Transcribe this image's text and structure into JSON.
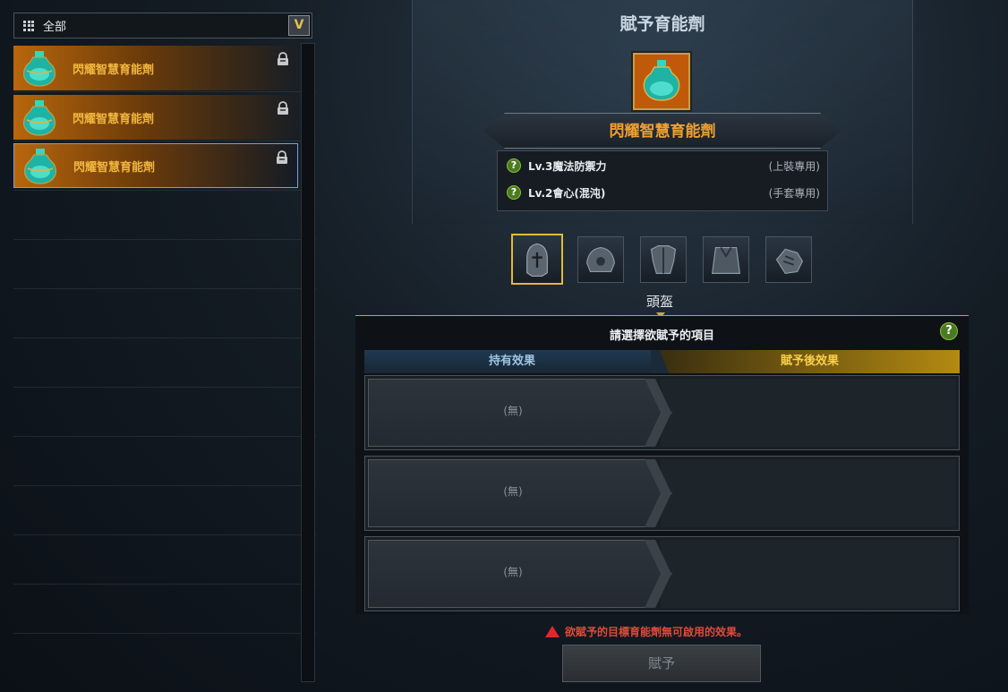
{
  "filter": {
    "label": "全部",
    "dropdown_glyph": "V"
  },
  "inventory": {
    "items": [
      {
        "name": "閃耀智慧育能劑",
        "icon": "teal-potion-icon",
        "locked": true,
        "selected": false
      },
      {
        "name": "閃耀智慧育能劑",
        "icon": "teal-potion-icon",
        "locked": true,
        "selected": false
      },
      {
        "name": "閃耀智慧育能劑",
        "icon": "teal-potion-icon",
        "locked": true,
        "selected": true
      }
    ]
  },
  "panel": {
    "title": "賦予育能劑",
    "item_name": "閃耀智慧育能劑",
    "effects": [
      {
        "text": "Lv.3魔法防禦力",
        "restriction": "(上裝專用)"
      },
      {
        "text": "Lv.2會心(混沌)",
        "restriction": "(手套專用)"
      }
    ],
    "equipment_slots": [
      "helmet-icon",
      "shoulder-icon",
      "armor-icon",
      "cloak-icon",
      "gauntlet-icon"
    ],
    "active_slot_label": "頭盔"
  },
  "detail": {
    "heading": "請選擇欲賦予的項目",
    "tab_current": "持有效果",
    "tab_after": "賦予後效果",
    "rows": [
      "(無)",
      "(無)",
      "(無)"
    ]
  },
  "warning": "欲賦予的目標育能劑無可啟用的效果。",
  "confirm_button": "賦予",
  "colors": {
    "accent_gold": "#e4b83a",
    "item_orange": "#f0b63e",
    "warning_red": "#e04a3a"
  }
}
